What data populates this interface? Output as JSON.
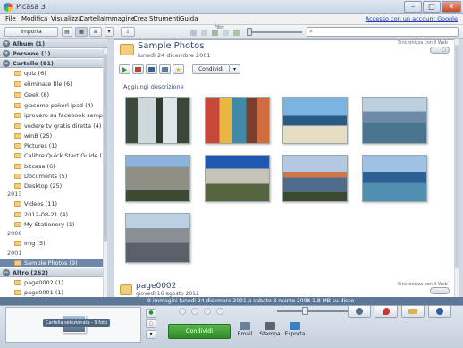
{
  "window": {
    "title": "Picasa 3",
    "controls": [
      "–",
      "□",
      "✕"
    ]
  },
  "menu": {
    "items": [
      "File",
      "Modifica",
      "Visualizza",
      "Cartella",
      "Immagine",
      "Crea",
      "Strumenti",
      "Guida"
    ],
    "account_link": "Accesso con un account Google"
  },
  "toolbar": {
    "import_label": "Importa",
    "filters_label": "Filtri"
  },
  "sidebar": {
    "sections": [
      {
        "label": "Album (1)",
        "collapsed": true
      },
      {
        "label": "Persone (1)",
        "collapsed": true
      },
      {
        "label": "Cartelle (91)",
        "collapsed": false
      }
    ],
    "folders_top": [
      "quiz (6)",
      "eliminate file (6)",
      "Geek (8)",
      "giacomo pokerl ipad (4)",
      "iprovero su facebook sempa ...",
      "vedere tv gratis diretta (4)",
      "winB (25)",
      "Pictures (1)",
      "Calibre Quick Start Guide (1) (1)",
      "bitcasa (6)",
      "Documents (5)",
      "Desktop (25)"
    ],
    "year_2013": "2013",
    "folders_2013": [
      "Videos (11)",
      "2012-08-21 (4)",
      "My Stationery (1)"
    ],
    "year_2008": "2008",
    "folders_2008": [
      "Img (5)"
    ],
    "year_2001": "2001",
    "selected_folder": "Sample Photos (9)",
    "other_section": "Altro (262)",
    "folders_other": [
      "page0002 (1)",
      "page0001 (1)"
    ]
  },
  "main": {
    "folder_title": "Sample Photos",
    "folder_date": "lunedì 24 dicembre 2001",
    "sync_label": "Sincronizza con il Web",
    "sync_toggle": "▢",
    "share_label": "Condividi",
    "add_description": "Aggiungi descrizione",
    "next_folder_title": "page0002",
    "next_folder_date": "giovedì 16 agosto 2012"
  },
  "status": {
    "text": "9 immagini  lunedì 24 dicembre 2001 a sabato 8 marzo 2008    1,8 MB su disco"
  },
  "tray": {
    "selection_chip": "Cartella selezionata - 9 foto",
    "share_button": "Condividi",
    "outputs": [
      {
        "label": "Email",
        "color": "#6a7f99"
      },
      {
        "label": "Stampa",
        "color": "#5b6470"
      },
      {
        "label": "Esporta",
        "color": "#3d7fc1"
      }
    ]
  },
  "colors": {
    "status_bar": "#5d7797",
    "share_green": "#3c9a33",
    "folder": "#f2cf7e",
    "selected": "#6e87a6"
  }
}
